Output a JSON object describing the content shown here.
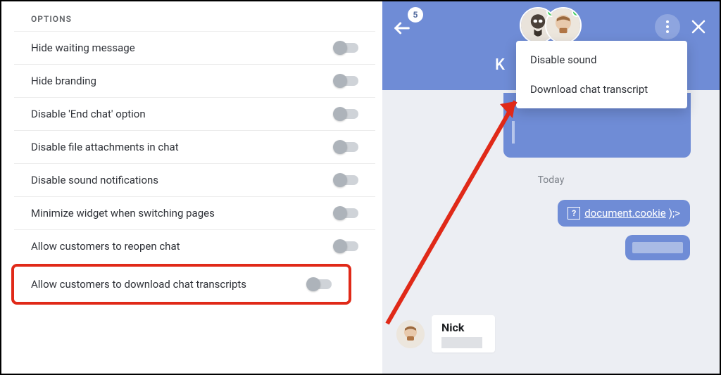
{
  "left": {
    "header": "OPTIONS",
    "items": [
      "Hide waiting message",
      "Hide branding",
      "Disable 'End chat' option",
      "Disable file attachments in chat",
      "Disable sound notifications",
      "Minimize widget when switching pages",
      "Allow customers to reopen chat"
    ],
    "highlighted": "Allow customers to download chat transcripts"
  },
  "right": {
    "badge": "5",
    "header_letter": "K",
    "menu": {
      "item1": "Disable sound",
      "item2": "Download chat transcript"
    },
    "today": "Today",
    "msg_link": "document.cookie",
    "msg_tail": ");>",
    "user_name": "Nick"
  }
}
